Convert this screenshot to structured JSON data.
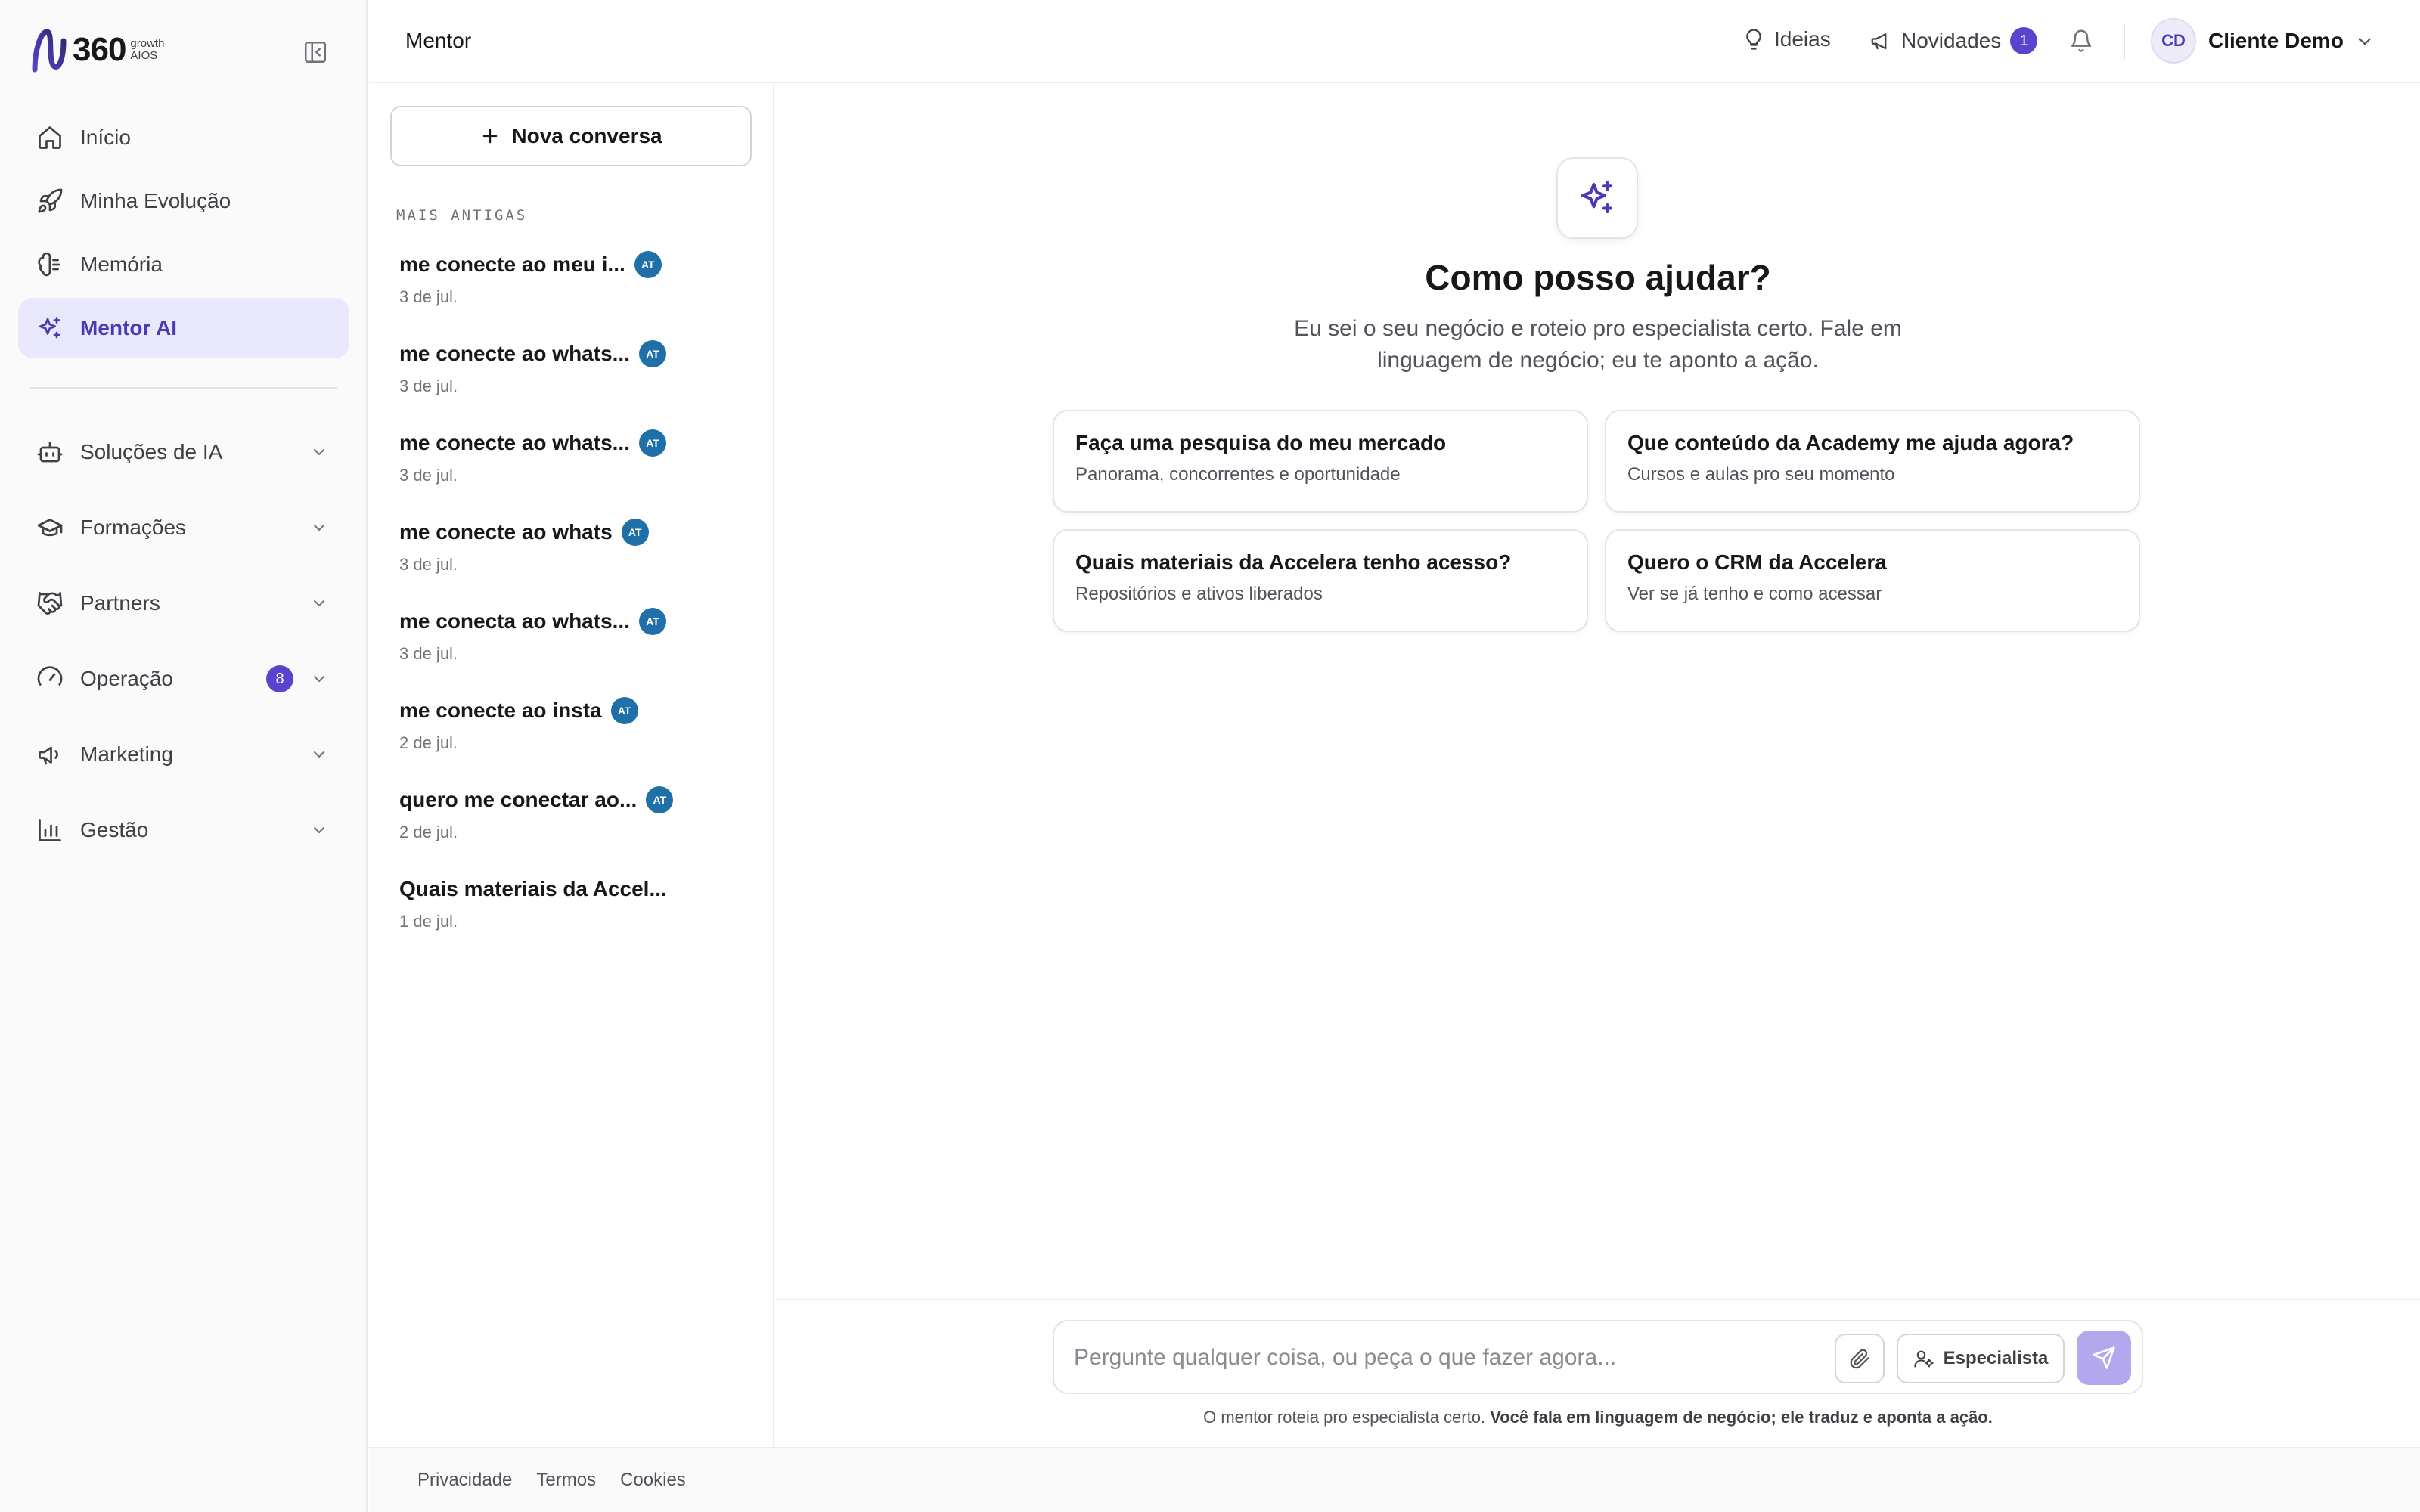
{
  "brand": {
    "name": "360",
    "tagline_1": "growth",
    "tagline_2": "AIOS",
    "accent": "#5b43d0"
  },
  "sidebar": {
    "primary": [
      {
        "label": "Início",
        "icon": "home-icon"
      },
      {
        "label": "Minha Evolução",
        "icon": "rocket-icon"
      },
      {
        "label": "Memória",
        "icon": "brain-icon"
      },
      {
        "label": "Mentor AI",
        "icon": "sparkles-icon",
        "active": true
      }
    ],
    "groups": [
      {
        "label": "Soluções de IA",
        "icon": "bot-icon"
      },
      {
        "label": "Formações",
        "icon": "graduation-cap-icon"
      },
      {
        "label": "Partners",
        "icon": "handshake-icon"
      },
      {
        "label": "Operação",
        "icon": "gauge-icon",
        "badge": "8"
      },
      {
        "label": "Marketing",
        "icon": "megaphone-icon"
      },
      {
        "label": "Gestão",
        "icon": "bar-chart-icon"
      }
    ]
  },
  "header": {
    "title": "Mentor",
    "ideas_label": "Ideias",
    "news_label": "Novidades",
    "news_badge": "1",
    "user_initials": "CD",
    "user_name": "Cliente Demo"
  },
  "conversations": {
    "new_label": "Nova conversa",
    "section_label": "MAIS ANTIGAS",
    "agent_badge": "AT",
    "items": [
      {
        "title": "me conecte ao meu i...",
        "date": "3 de jul.",
        "badge": true
      },
      {
        "title": "me conecte ao whats...",
        "date": "3 de jul.",
        "badge": true
      },
      {
        "title": "me conecte ao whats...",
        "date": "3 de jul.",
        "badge": true
      },
      {
        "title": "me conecte ao whats",
        "date": "3 de jul.",
        "badge": true
      },
      {
        "title": "me conecta ao whats...",
        "date": "3 de jul.",
        "badge": true
      },
      {
        "title": "me conecte ao insta",
        "date": "2 de jul.",
        "badge": true
      },
      {
        "title": "quero me conectar ao...",
        "date": "2 de jul.",
        "badge": true
      },
      {
        "title": "Quais materiais da Accel...",
        "date": "1 de jul.",
        "badge": false
      }
    ]
  },
  "main": {
    "title": "Como posso ajudar?",
    "subtitle": "Eu sei o seu negócio e roteio pro especialista certo. Fale em linguagem de negócio; eu te aponto a ação.",
    "suggestions": [
      {
        "title": "Faça uma pesquisa do meu mercado",
        "subtitle": "Panorama, concorrentes e oportunidade"
      },
      {
        "title": "Que conteúdo da Academy me ajuda agora?",
        "subtitle": "Cursos e aulas pro seu momento"
      },
      {
        "title": "Quais materiais da Accelera tenho acesso?",
        "subtitle": "Repositórios e ativos liberados"
      },
      {
        "title": "Quero o CRM da Accelera",
        "subtitle": "Ver se já tenho e como acessar"
      }
    ]
  },
  "composer": {
    "placeholder": "Pergunte qualquer coisa, ou peça o que fazer agora...",
    "value": "",
    "expert_label": "Especialista",
    "disclaimer_plain": "O mentor roteia pro especialista certo.",
    "disclaimer_bold": "Você fala em linguagem de negócio; ele traduz e aponta a ação."
  },
  "footer": {
    "links": [
      "Privacidade",
      "Termos",
      "Cookies"
    ]
  }
}
